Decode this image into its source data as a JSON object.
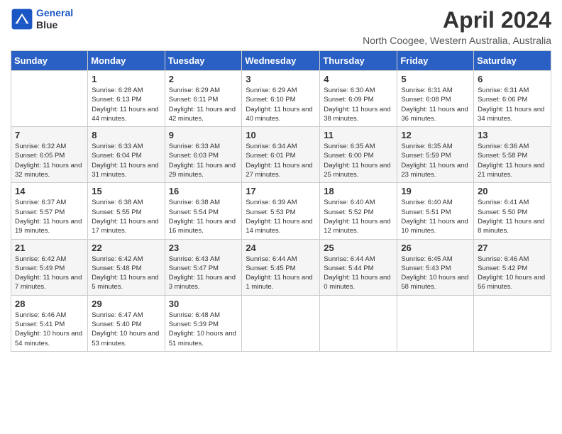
{
  "header": {
    "logo_line1": "General",
    "logo_line2": "Blue",
    "month_year": "April 2024",
    "location": "North Coogee, Western Australia, Australia"
  },
  "weekdays": [
    "Sunday",
    "Monday",
    "Tuesday",
    "Wednesday",
    "Thursday",
    "Friday",
    "Saturday"
  ],
  "weeks": [
    [
      {
        "day": "",
        "sunrise": "",
        "sunset": "",
        "daylight": ""
      },
      {
        "day": "1",
        "sunrise": "Sunrise: 6:28 AM",
        "sunset": "Sunset: 6:13 PM",
        "daylight": "Daylight: 11 hours and 44 minutes."
      },
      {
        "day": "2",
        "sunrise": "Sunrise: 6:29 AM",
        "sunset": "Sunset: 6:11 PM",
        "daylight": "Daylight: 11 hours and 42 minutes."
      },
      {
        "day": "3",
        "sunrise": "Sunrise: 6:29 AM",
        "sunset": "Sunset: 6:10 PM",
        "daylight": "Daylight: 11 hours and 40 minutes."
      },
      {
        "day": "4",
        "sunrise": "Sunrise: 6:30 AM",
        "sunset": "Sunset: 6:09 PM",
        "daylight": "Daylight: 11 hours and 38 minutes."
      },
      {
        "day": "5",
        "sunrise": "Sunrise: 6:31 AM",
        "sunset": "Sunset: 6:08 PM",
        "daylight": "Daylight: 11 hours and 36 minutes."
      },
      {
        "day": "6",
        "sunrise": "Sunrise: 6:31 AM",
        "sunset": "Sunset: 6:06 PM",
        "daylight": "Daylight: 11 hours and 34 minutes."
      }
    ],
    [
      {
        "day": "7",
        "sunrise": "Sunrise: 6:32 AM",
        "sunset": "Sunset: 6:05 PM",
        "daylight": "Daylight: 11 hours and 32 minutes."
      },
      {
        "day": "8",
        "sunrise": "Sunrise: 6:33 AM",
        "sunset": "Sunset: 6:04 PM",
        "daylight": "Daylight: 11 hours and 31 minutes."
      },
      {
        "day": "9",
        "sunrise": "Sunrise: 6:33 AM",
        "sunset": "Sunset: 6:03 PM",
        "daylight": "Daylight: 11 hours and 29 minutes."
      },
      {
        "day": "10",
        "sunrise": "Sunrise: 6:34 AM",
        "sunset": "Sunset: 6:01 PM",
        "daylight": "Daylight: 11 hours and 27 minutes."
      },
      {
        "day": "11",
        "sunrise": "Sunrise: 6:35 AM",
        "sunset": "Sunset: 6:00 PM",
        "daylight": "Daylight: 11 hours and 25 minutes."
      },
      {
        "day": "12",
        "sunrise": "Sunrise: 6:35 AM",
        "sunset": "Sunset: 5:59 PM",
        "daylight": "Daylight: 11 hours and 23 minutes."
      },
      {
        "day": "13",
        "sunrise": "Sunrise: 6:36 AM",
        "sunset": "Sunset: 5:58 PM",
        "daylight": "Daylight: 11 hours and 21 minutes."
      }
    ],
    [
      {
        "day": "14",
        "sunrise": "Sunrise: 6:37 AM",
        "sunset": "Sunset: 5:57 PM",
        "daylight": "Daylight: 11 hours and 19 minutes."
      },
      {
        "day": "15",
        "sunrise": "Sunrise: 6:38 AM",
        "sunset": "Sunset: 5:55 PM",
        "daylight": "Daylight: 11 hours and 17 minutes."
      },
      {
        "day": "16",
        "sunrise": "Sunrise: 6:38 AM",
        "sunset": "Sunset: 5:54 PM",
        "daylight": "Daylight: 11 hours and 16 minutes."
      },
      {
        "day": "17",
        "sunrise": "Sunrise: 6:39 AM",
        "sunset": "Sunset: 5:53 PM",
        "daylight": "Daylight: 11 hours and 14 minutes."
      },
      {
        "day": "18",
        "sunrise": "Sunrise: 6:40 AM",
        "sunset": "Sunset: 5:52 PM",
        "daylight": "Daylight: 11 hours and 12 minutes."
      },
      {
        "day": "19",
        "sunrise": "Sunrise: 6:40 AM",
        "sunset": "Sunset: 5:51 PM",
        "daylight": "Daylight: 11 hours and 10 minutes."
      },
      {
        "day": "20",
        "sunrise": "Sunrise: 6:41 AM",
        "sunset": "Sunset: 5:50 PM",
        "daylight": "Daylight: 11 hours and 8 minutes."
      }
    ],
    [
      {
        "day": "21",
        "sunrise": "Sunrise: 6:42 AM",
        "sunset": "Sunset: 5:49 PM",
        "daylight": "Daylight: 11 hours and 7 minutes."
      },
      {
        "day": "22",
        "sunrise": "Sunrise: 6:42 AM",
        "sunset": "Sunset: 5:48 PM",
        "daylight": "Daylight: 11 hours and 5 minutes."
      },
      {
        "day": "23",
        "sunrise": "Sunrise: 6:43 AM",
        "sunset": "Sunset: 5:47 PM",
        "daylight": "Daylight: 11 hours and 3 minutes."
      },
      {
        "day": "24",
        "sunrise": "Sunrise: 6:44 AM",
        "sunset": "Sunset: 5:45 PM",
        "daylight": "Daylight: 11 hours and 1 minute."
      },
      {
        "day": "25",
        "sunrise": "Sunrise: 6:44 AM",
        "sunset": "Sunset: 5:44 PM",
        "daylight": "Daylight: 11 hours and 0 minutes."
      },
      {
        "day": "26",
        "sunrise": "Sunrise: 6:45 AM",
        "sunset": "Sunset: 5:43 PM",
        "daylight": "Daylight: 10 hours and 58 minutes."
      },
      {
        "day": "27",
        "sunrise": "Sunrise: 6:46 AM",
        "sunset": "Sunset: 5:42 PM",
        "daylight": "Daylight: 10 hours and 56 minutes."
      }
    ],
    [
      {
        "day": "28",
        "sunrise": "Sunrise: 6:46 AM",
        "sunset": "Sunset: 5:41 PM",
        "daylight": "Daylight: 10 hours and 54 minutes."
      },
      {
        "day": "29",
        "sunrise": "Sunrise: 6:47 AM",
        "sunset": "Sunset: 5:40 PM",
        "daylight": "Daylight: 10 hours and 53 minutes."
      },
      {
        "day": "30",
        "sunrise": "Sunrise: 6:48 AM",
        "sunset": "Sunset: 5:39 PM",
        "daylight": "Daylight: 10 hours and 51 minutes."
      },
      {
        "day": "",
        "sunrise": "",
        "sunset": "",
        "daylight": ""
      },
      {
        "day": "",
        "sunrise": "",
        "sunset": "",
        "daylight": ""
      },
      {
        "day": "",
        "sunrise": "",
        "sunset": "",
        "daylight": ""
      },
      {
        "day": "",
        "sunrise": "",
        "sunset": "",
        "daylight": ""
      }
    ]
  ]
}
